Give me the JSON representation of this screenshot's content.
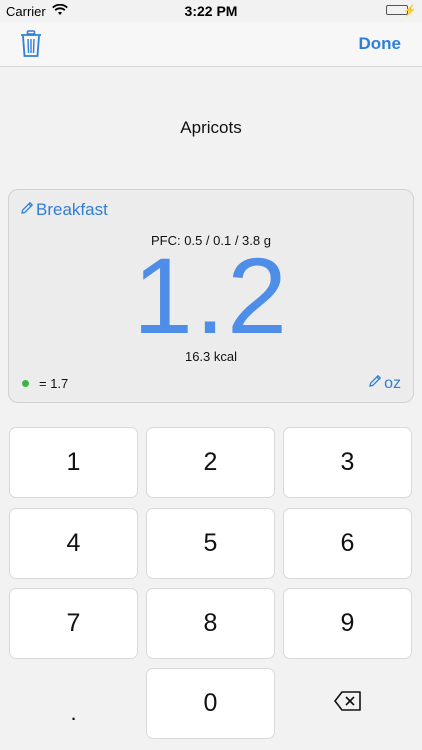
{
  "status_bar": {
    "carrier": "Carrier",
    "time": "3:22 PM",
    "battery_level": 1.0
  },
  "nav": {
    "done_label": "Done",
    "trash_icon": "trash-icon"
  },
  "food": {
    "name": "Apricots"
  },
  "card": {
    "meal_label": "Breakfast",
    "pfc": "PFC: 0.5 / 0.1 / 3.8 g",
    "amount": "1.2",
    "kcal": "16.3 kcal",
    "ratio": "= 1.7",
    "unit": "oz"
  },
  "keypad": {
    "keys": [
      "1",
      "2",
      "3",
      "4",
      "5",
      "6",
      "7",
      "8",
      "9",
      ".",
      "0",
      "⌫"
    ]
  },
  "colors": {
    "accent": "#2f7fd6",
    "amount": "#4f8ee8",
    "dot": "#3cb44b",
    "background": "#f2f2f2"
  }
}
